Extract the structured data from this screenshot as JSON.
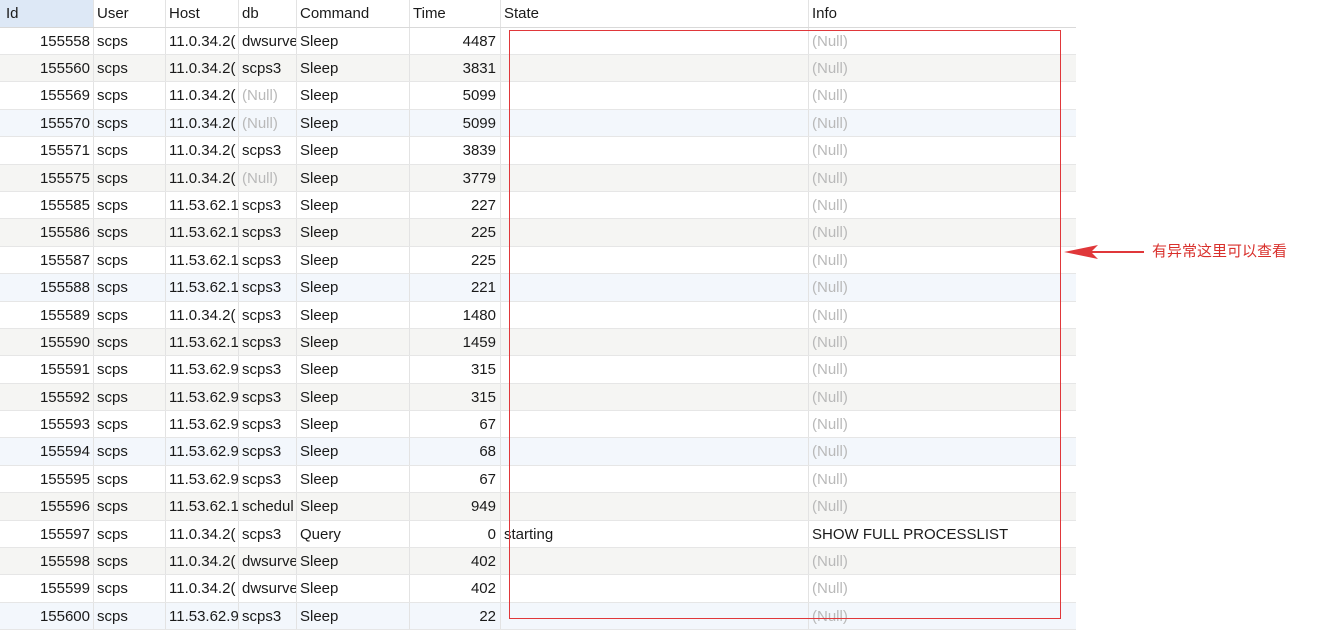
{
  "table": {
    "columns": [
      "Id",
      "User",
      "Host",
      "db",
      "Command",
      "Time",
      "State",
      "Info"
    ],
    "rows": [
      {
        "id": "155558",
        "user": "scps",
        "host": "11.0.34.2(",
        "db": "dwsurve",
        "command": "Sleep",
        "time": "4487",
        "state": "",
        "info": "(Null)"
      },
      {
        "id": "155560",
        "user": "scps",
        "host": "11.0.34.2(",
        "db": "scps3",
        "command": "Sleep",
        "time": "3831",
        "state": "",
        "info": "(Null)"
      },
      {
        "id": "155569",
        "user": "scps",
        "host": "11.0.34.2(",
        "db": "(Null)",
        "command": "Sleep",
        "time": "5099",
        "state": "",
        "info": "(Null)"
      },
      {
        "id": "155570",
        "user": "scps",
        "host": "11.0.34.2(",
        "db": "(Null)",
        "command": "Sleep",
        "time": "5099",
        "state": "",
        "info": "(Null)"
      },
      {
        "id": "155571",
        "user": "scps",
        "host": "11.0.34.2(",
        "db": "scps3",
        "command": "Sleep",
        "time": "3839",
        "state": "",
        "info": "(Null)"
      },
      {
        "id": "155575",
        "user": "scps",
        "host": "11.0.34.2(",
        "db": "(Null)",
        "command": "Sleep",
        "time": "3779",
        "state": "",
        "info": "(Null)"
      },
      {
        "id": "155585",
        "user": "scps",
        "host": "11.53.62.1",
        "db": "scps3",
        "command": "Sleep",
        "time": "227",
        "state": "",
        "info": "(Null)"
      },
      {
        "id": "155586",
        "user": "scps",
        "host": "11.53.62.1",
        "db": "scps3",
        "command": "Sleep",
        "time": "225",
        "state": "",
        "info": "(Null)"
      },
      {
        "id": "155587",
        "user": "scps",
        "host": "11.53.62.1",
        "db": "scps3",
        "command": "Sleep",
        "time": "225",
        "state": "",
        "info": "(Null)"
      },
      {
        "id": "155588",
        "user": "scps",
        "host": "11.53.62.1",
        "db": "scps3",
        "command": "Sleep",
        "time": "221",
        "state": "",
        "info": "(Null)"
      },
      {
        "id": "155589",
        "user": "scps",
        "host": "11.0.34.2(",
        "db": "scps3",
        "command": "Sleep",
        "time": "1480",
        "state": "",
        "info": "(Null)"
      },
      {
        "id": "155590",
        "user": "scps",
        "host": "11.53.62.1",
        "db": "scps3",
        "command": "Sleep",
        "time": "1459",
        "state": "",
        "info": "(Null)"
      },
      {
        "id": "155591",
        "user": "scps",
        "host": "11.53.62.9",
        "db": "scps3",
        "command": "Sleep",
        "time": "315",
        "state": "",
        "info": "(Null)"
      },
      {
        "id": "155592",
        "user": "scps",
        "host": "11.53.62.9",
        "db": "scps3",
        "command": "Sleep",
        "time": "315",
        "state": "",
        "info": "(Null)"
      },
      {
        "id": "155593",
        "user": "scps",
        "host": "11.53.62.9",
        "db": "scps3",
        "command": "Sleep",
        "time": "67",
        "state": "",
        "info": "(Null)"
      },
      {
        "id": "155594",
        "user": "scps",
        "host": "11.53.62.9",
        "db": "scps3",
        "command": "Sleep",
        "time": "68",
        "state": "",
        "info": "(Null)"
      },
      {
        "id": "155595",
        "user": "scps",
        "host": "11.53.62.9",
        "db": "scps3",
        "command": "Sleep",
        "time": "67",
        "state": "",
        "info": "(Null)"
      },
      {
        "id": "155596",
        "user": "scps",
        "host": "11.53.62.1",
        "db": "schedul",
        "command": "Sleep",
        "time": "949",
        "state": "",
        "info": "(Null)"
      },
      {
        "id": "155597",
        "user": "scps",
        "host": "11.0.34.2(",
        "db": "scps3",
        "command": "Query",
        "time": "0",
        "state": "starting",
        "info": "SHOW FULL PROCESSLIST"
      },
      {
        "id": "155598",
        "user": "scps",
        "host": "11.0.34.2(",
        "db": "dwsurve",
        "command": "Sleep",
        "time": "402",
        "state": "",
        "info": "(Null)"
      },
      {
        "id": "155599",
        "user": "scps",
        "host": "11.0.34.2(",
        "db": "dwsurve",
        "command": "Sleep",
        "time": "402",
        "state": "",
        "info": "(Null)"
      },
      {
        "id": "155600",
        "user": "scps",
        "host": "11.53.62.9",
        "db": "scps3",
        "command": "Sleep",
        "time": "22",
        "state": "",
        "info": "(Null)"
      }
    ]
  },
  "annotation": {
    "text": "有异常这里可以查看",
    "color": "#d9302c"
  }
}
